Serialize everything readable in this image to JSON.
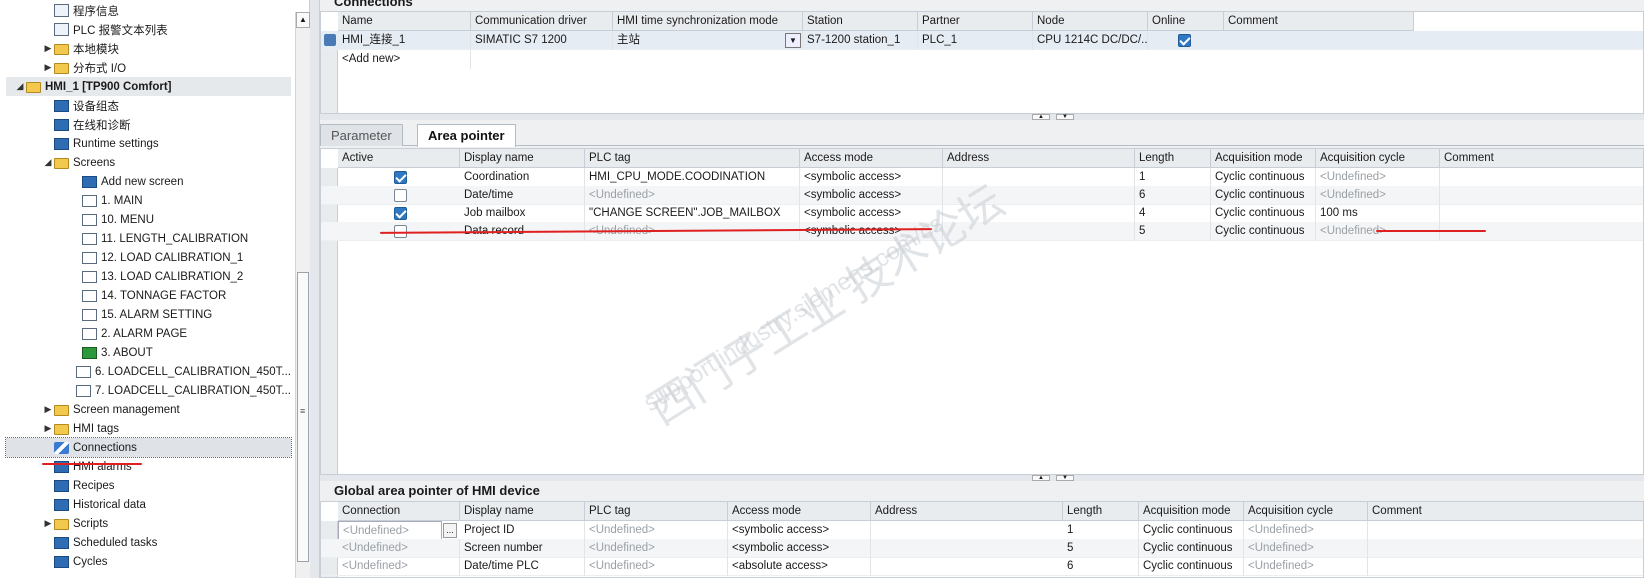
{
  "tree": {
    "items": [
      {
        "label": "程序信息",
        "level": 3,
        "icon": "doc-icon",
        "expand": ""
      },
      {
        "label": "PLC 报警文本列表",
        "level": 3,
        "icon": "doc-icon",
        "expand": ""
      },
      {
        "label": "本地模块",
        "level": 3,
        "icon": "folder-icon",
        "expand": "▶"
      },
      {
        "label": "分布式 I/O",
        "level": 3,
        "icon": "folder-icon",
        "expand": "▶"
      },
      {
        "label": "HMI_1 [TP900 Comfort]",
        "level": 1,
        "icon": "folder-icon",
        "expand": "◢"
      },
      {
        "label": "设备组态",
        "level": 3,
        "icon": "device-config-icon",
        "expand": ""
      },
      {
        "label": "在线和诊断",
        "level": 3,
        "icon": "online-diagnostics-icon",
        "expand": ""
      },
      {
        "label": "Runtime settings",
        "level": 3,
        "icon": "runtime-settings-icon",
        "expand": ""
      },
      {
        "label": "Screens",
        "level": 3,
        "icon": "folder-icon",
        "expand": "◢"
      },
      {
        "label": "Add new screen",
        "level": 5,
        "icon": "add-screen-icon",
        "expand": ""
      },
      {
        "label": "1. MAIN",
        "level": 5,
        "icon": "screen-icon",
        "expand": ""
      },
      {
        "label": "10. MENU",
        "level": 5,
        "icon": "screen-icon",
        "expand": ""
      },
      {
        "label": "11. LENGTH_CALIBRATION",
        "level": 5,
        "icon": "screen-icon",
        "expand": ""
      },
      {
        "label": "12. LOAD CALIBRATION_1",
        "level": 5,
        "icon": "screen-icon",
        "expand": ""
      },
      {
        "label": "13. LOAD CALIBRATION_2",
        "level": 5,
        "icon": "screen-icon",
        "expand": ""
      },
      {
        "label": "14. TONNAGE FACTOR",
        "level": 5,
        "icon": "screen-icon",
        "expand": ""
      },
      {
        "label": "15. ALARM SETTING",
        "level": 5,
        "icon": "screen-icon",
        "expand": ""
      },
      {
        "label": "2. ALARM PAGE",
        "level": 5,
        "icon": "screen-icon",
        "expand": ""
      },
      {
        "label": "3. ABOUT",
        "level": 5,
        "icon": "start-screen-icon",
        "expand": ""
      },
      {
        "label": "6. LOADCELL_CALIBRATION_450T...",
        "level": 5,
        "icon": "screen-icon",
        "expand": ""
      },
      {
        "label": "7. LOADCELL_CALIBRATION_450T...",
        "level": 5,
        "icon": "screen-icon",
        "expand": ""
      },
      {
        "label": "Screen management",
        "level": 3,
        "icon": "folder-icon",
        "expand": "▶"
      },
      {
        "label": "HMI tags",
        "level": 3,
        "icon": "folder-icon",
        "expand": "▶"
      },
      {
        "label": "Connections",
        "level": 3,
        "icon": "connections-icon",
        "expand": ""
      },
      {
        "label": "HMI alarms",
        "level": 3,
        "icon": "alarms-icon",
        "expand": ""
      },
      {
        "label": "Recipes",
        "level": 3,
        "icon": "recipes-icon",
        "expand": ""
      },
      {
        "label": "Historical data",
        "level": 3,
        "icon": "historical-data-icon",
        "expand": ""
      },
      {
        "label": "Scripts",
        "level": 3,
        "icon": "folder-icon",
        "expand": "▶"
      },
      {
        "label": "Scheduled tasks",
        "level": 3,
        "icon": "scheduled-tasks-icon",
        "expand": ""
      },
      {
        "label": "Cycles",
        "level": 3,
        "icon": "cycles-icon",
        "expand": ""
      }
    ]
  },
  "connections": {
    "title": "Connections",
    "headers": [
      "Name",
      "Communication driver",
      "HMI time synchronization mode",
      "Station",
      "Partner",
      "Node",
      "Online",
      "Comment"
    ],
    "row": {
      "name": "HMI_连接_1",
      "driver": "SIMATIC S7 1200",
      "sync": "主站",
      "station": "S7-1200 station_1",
      "partner": "PLC_1",
      "node": "CPU 1214C DC/DC/...",
      "online": true
    },
    "add_new": "<Add new>"
  },
  "tabs": {
    "parameter": "Parameter",
    "area_pointer": "Area pointer"
  },
  "area": {
    "headers": [
      "Active",
      "Display name",
      "PLC tag",
      "Access mode",
      "Address",
      "Length",
      "Acquisition mode",
      "Acquisition cycle",
      "Comment"
    ],
    "rows": [
      {
        "active": true,
        "name": "Coordination",
        "tag": "HMI_CPU_MODE.COODINATION",
        "access": "<symbolic access>",
        "address": "",
        "length": "1",
        "mode": "Cyclic continuous",
        "cycle": "<Undefined>",
        "tag_undef": false,
        "cycle_undef": true
      },
      {
        "active": false,
        "name": "Date/time",
        "tag": "<Undefined>",
        "access": "<symbolic access>",
        "address": "",
        "length": "6",
        "mode": "Cyclic continuous",
        "cycle": "<Undefined>",
        "tag_undef": true,
        "cycle_undef": true
      },
      {
        "active": true,
        "name": "Job mailbox",
        "tag": "\"CHANGE SCREEN\".JOB_MAILBOX",
        "access": "<symbolic access>",
        "address": "",
        "length": "4",
        "mode": "Cyclic continuous",
        "cycle": "100 ms",
        "tag_undef": false,
        "cycle_undef": false
      },
      {
        "active": false,
        "name": "Data record",
        "tag": "<Undefined>",
        "access": "<symbolic access>",
        "address": "",
        "length": "5",
        "mode": "Cyclic continuous",
        "cycle": "<Undefined>",
        "tag_undef": true,
        "cycle_undef": true
      }
    ]
  },
  "global": {
    "title": "Global area pointer of HMI device",
    "headers": [
      "Connection",
      "Display name",
      "PLC tag",
      "Access mode",
      "Address",
      "Length",
      "Acquisition mode",
      "Acquisition cycle",
      "Comment"
    ],
    "rows": [
      {
        "connection": "<Undefined>",
        "name": "Project ID",
        "tag": "<Undefined>",
        "access": "<symbolic access>",
        "length": "1",
        "mode": "Cyclic continuous",
        "cycle": "<Undefined>"
      },
      {
        "connection": "<Undefined>",
        "name": "Screen number",
        "tag": "<Undefined>",
        "access": "<symbolic access>",
        "length": "5",
        "mode": "Cyclic continuous",
        "cycle": "<Undefined>"
      },
      {
        "connection": "<Undefined>",
        "name": "Date/time PLC",
        "tag": "<Undefined>",
        "access": "<absolute access>",
        "length": "6",
        "mode": "Cyclic continuous",
        "cycle": "<Undefined>"
      }
    ]
  },
  "watermark": {
    "line1": "西门子工业 技术论坛",
    "line2": "support.industry.siemens.com/cs"
  },
  "colors": {
    "accent": "#2f79c2",
    "annotation": "#e02020",
    "header_bg": "#e9ecef"
  }
}
